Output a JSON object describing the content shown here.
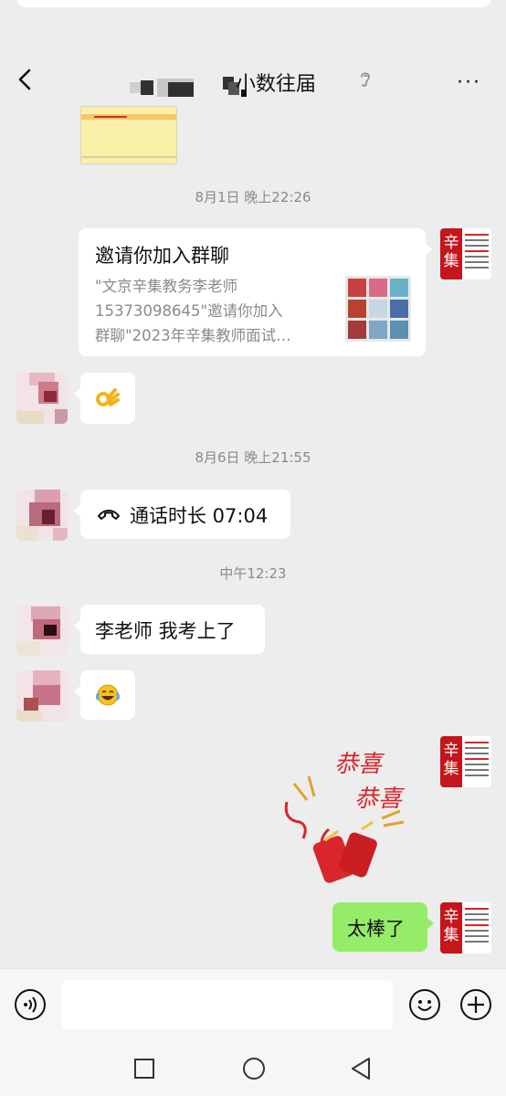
{
  "header": {
    "title": "小数往届",
    "more": "···"
  },
  "timestamps": {
    "t1": "8月1日 晚上22:26",
    "t2": "8月6日 晚上21:55",
    "t3": "中午12:23"
  },
  "messages": {
    "invite_title": "邀请你加入群聊",
    "invite_line1": "\"文京辛集教务李老师",
    "invite_line2": "15373098645\"邀请你加入",
    "invite_line3": "群聊\"2023年辛集教师面试…",
    "call_text": "通话时长 07:04",
    "passed_text": "李老师 我考上了",
    "sticker_text_1": "恭喜",
    "sticker_text_2": "恭喜",
    "reply_text": "太棒了"
  },
  "brand": {
    "avatar_char_1": "辛",
    "avatar_char_2": "集"
  },
  "colors": {
    "background": "#ededed",
    "my_bubble": "#95ec69",
    "brand_red": "#c4161c"
  }
}
